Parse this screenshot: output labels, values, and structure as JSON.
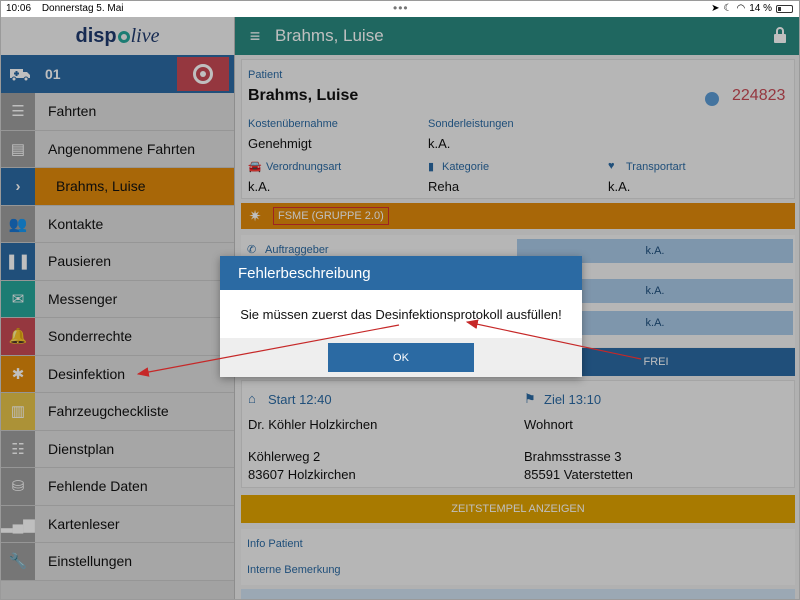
{
  "status_bar": {
    "time": "10:06",
    "date": "Donnerstag 5. Mai",
    "battery": "14 %"
  },
  "logo": {
    "part1": "disp",
    "part2": "live"
  },
  "vehicle": {
    "number": "01"
  },
  "sidebar": {
    "items": [
      {
        "label": "Fahrten",
        "icon": "list-check-icon"
      },
      {
        "label": "Angenommene Fahrten",
        "icon": "id-card-icon"
      },
      {
        "label": "Brahms, Luise",
        "icon": "chevron-right-icon",
        "active": true
      },
      {
        "label": "Kontakte",
        "icon": "users-icon"
      },
      {
        "label": "Pausieren",
        "icon": "pause-icon"
      },
      {
        "label": "Messenger",
        "icon": "envelope-icon"
      },
      {
        "label": "Sonderrechte",
        "icon": "bell-icon"
      },
      {
        "label": "Desinfektion",
        "icon": "bug-icon"
      },
      {
        "label": "Fahrzeugcheckliste",
        "icon": "book-icon"
      },
      {
        "label": "Dienstplan",
        "icon": "list-icon"
      },
      {
        "label": "Fehlende Daten",
        "icon": "database-icon"
      },
      {
        "label": "Kartenleser",
        "icon": "signal-icon"
      },
      {
        "label": "Einstellungen",
        "icon": "wrench-icon"
      }
    ]
  },
  "header": {
    "title": "Brahms, Luise"
  },
  "patient": {
    "label": "Patient",
    "name": "Brahms, Luise",
    "id": "224823",
    "kostenuebernahme_label": "Kostenübernahme",
    "kostenuebernahme": "Genehmigt",
    "sonderleistungen_label": "Sonderleistungen",
    "sonderleistungen": "k.A.",
    "verordnungsart_label": "Verordnungsart",
    "verordnungsart": "k.A.",
    "kategorie_label": "Kategorie",
    "kategorie": "Reha",
    "transportart_label": "Transportart",
    "transportart": "k.A."
  },
  "fsme": {
    "label": "FSME (GRUPPE 2.0)"
  },
  "auftrag": {
    "label": "Auftraggeber",
    "buttons": [
      "k.A.",
      "k.A.",
      "k.A."
    ]
  },
  "frei": {
    "label": "FREI"
  },
  "route": {
    "start_label": "Start 12:40",
    "start_name": "Dr. Köhler Holzkirchen",
    "start_street": "Köhlerweg 2",
    "start_city": "83607 Holzkirchen",
    "ziel_label": "Ziel 13:10",
    "ziel_name": "Wohnort",
    "ziel_street": "Brahmsstrasse 3",
    "ziel_city": "85591 Vaterstetten"
  },
  "zeitstempel": {
    "label": "ZEITSTEMPEL ANZEIGEN"
  },
  "info": {
    "patient_label": "Info Patient",
    "bemerkung_label": "Interne Bemerkung"
  },
  "dialog": {
    "title": "Fehlerbeschreibung",
    "message": "Sie müssen zuerst das Desinfektionsprotokoll ausfüllen!",
    "ok": "OK"
  },
  "colors": {
    "primary": "#2b6aa3",
    "teal": "#2a8a80",
    "orange": "#e08a0b",
    "red": "#c74a55",
    "yellow": "#e0a300"
  }
}
